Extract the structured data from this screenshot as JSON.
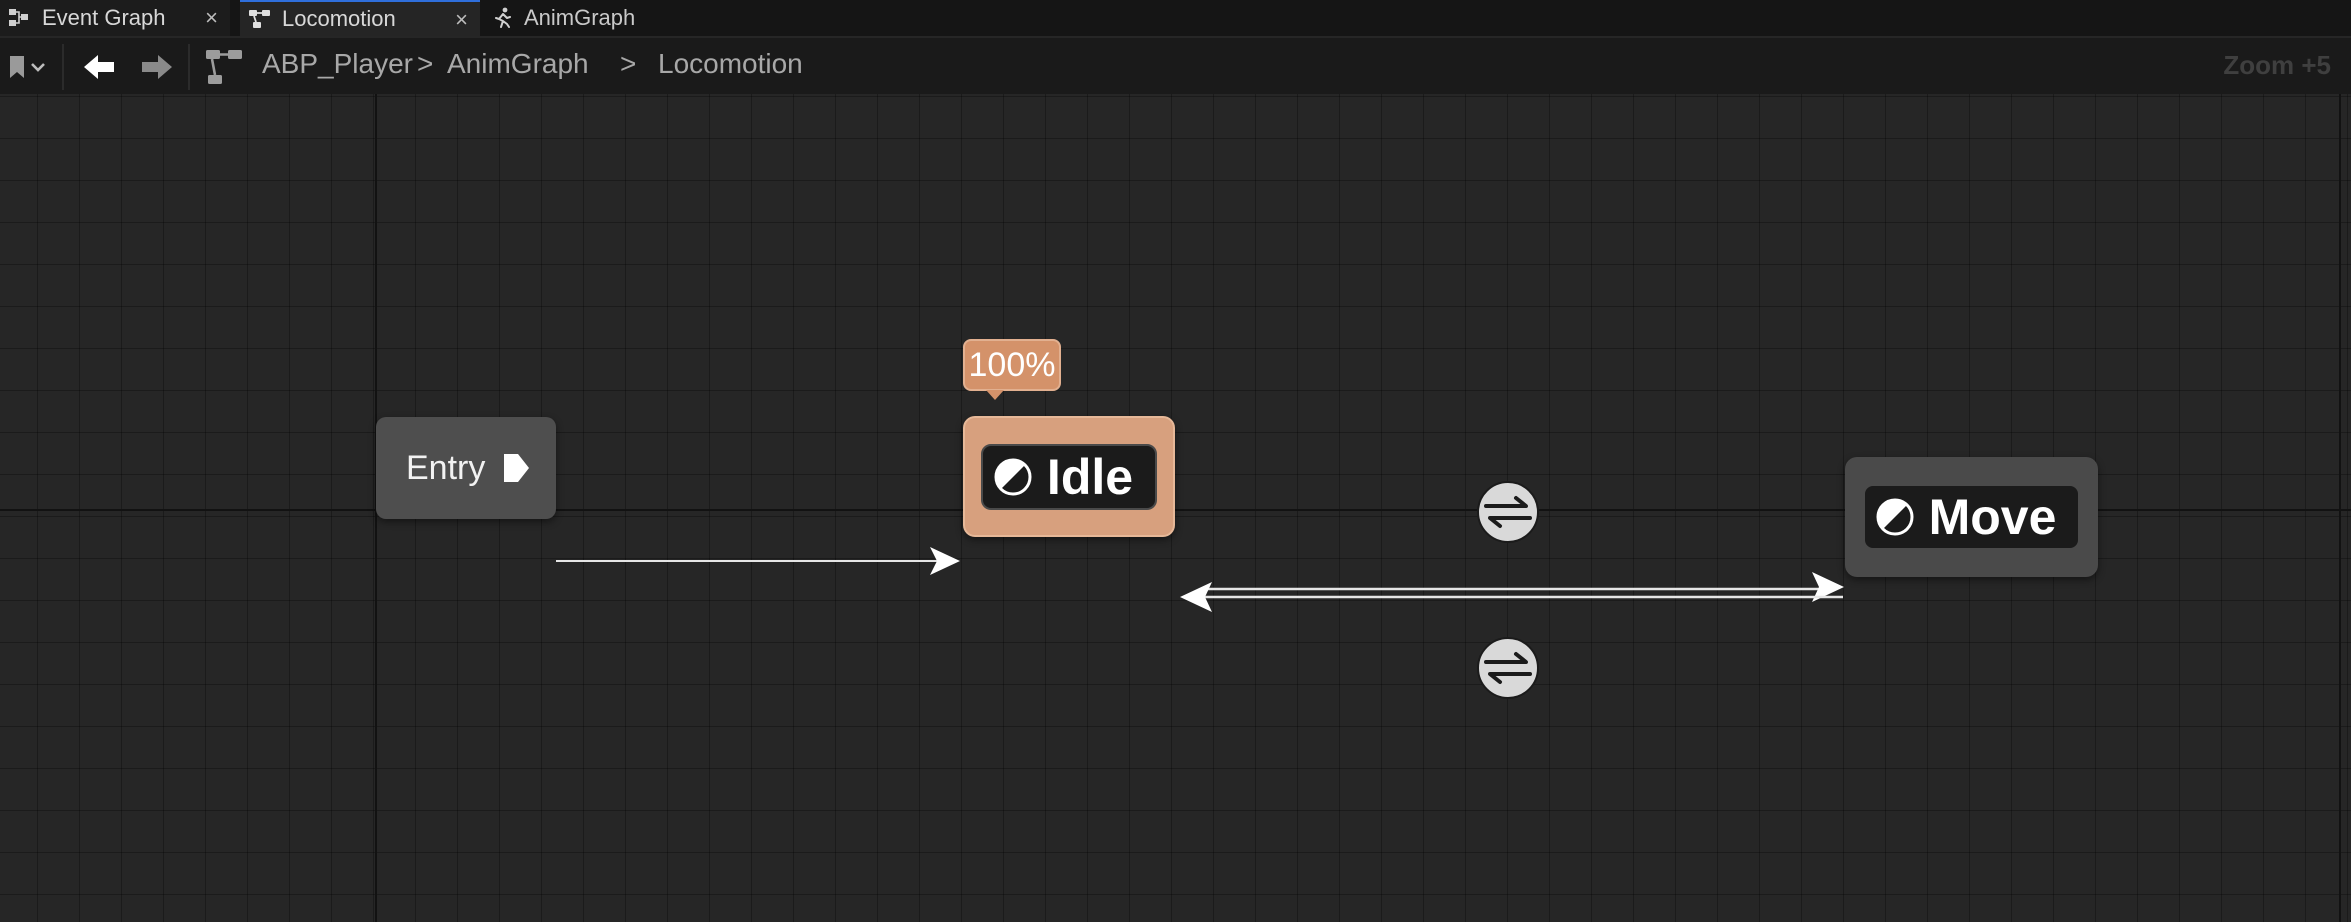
{
  "tabs": [
    {
      "label": "Event Graph",
      "icon": "event-graph-icon",
      "closable": true,
      "active": false
    },
    {
      "label": "Locomotion",
      "icon": "state-machine-icon",
      "closable": true,
      "active": true
    },
    {
      "label": "AnimGraph",
      "icon": "running-figure-icon",
      "closable": false,
      "active": false
    }
  ],
  "toolbar": {
    "breadcrumb": [
      "ABP_Player",
      "AnimGraph",
      "Locomotion"
    ],
    "separator_1": ">",
    "separator_2": ">",
    "zoom": "Zoom +5"
  },
  "graph": {
    "entry_label": "Entry",
    "idle": {
      "label": "Idle",
      "weight_badge": "100%",
      "active": true
    },
    "move": {
      "label": "Move",
      "active": false
    },
    "transitions": [
      {
        "from": "Entry",
        "to": "Idle"
      },
      {
        "from": "Idle",
        "to": "Move"
      },
      {
        "from": "Move",
        "to": "Idle"
      }
    ]
  },
  "colors": {
    "active_state": "#d7a07e",
    "badge": "#d4926a",
    "inactive_state": "#4a4a4a",
    "canvas": "#262626",
    "tab_accent": "#2f6fdc"
  }
}
